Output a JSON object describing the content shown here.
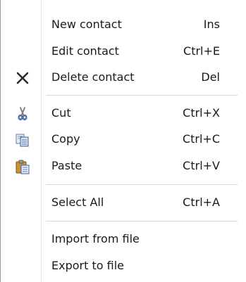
{
  "menu": {
    "items": [
      {
        "label": "New contact",
        "shortcut": "Ins",
        "icon": ""
      },
      {
        "label": "Edit contact",
        "shortcut": "Ctrl+E",
        "icon": ""
      },
      {
        "label": "Delete contact",
        "shortcut": "Del",
        "icon": "delete-x-icon"
      },
      {
        "label": "Cut",
        "shortcut": "Ctrl+X",
        "icon": "scissors-icon"
      },
      {
        "label": "Copy",
        "shortcut": "Ctrl+C",
        "icon": "copy-icon"
      },
      {
        "label": "Paste",
        "shortcut": "Ctrl+V",
        "icon": "clipboard-icon"
      },
      {
        "label": "Select All",
        "shortcut": "Ctrl+A",
        "icon": ""
      },
      {
        "label": "Import from file",
        "shortcut": "",
        "icon": ""
      },
      {
        "label": "Export to file",
        "shortcut": "",
        "icon": ""
      }
    ]
  }
}
